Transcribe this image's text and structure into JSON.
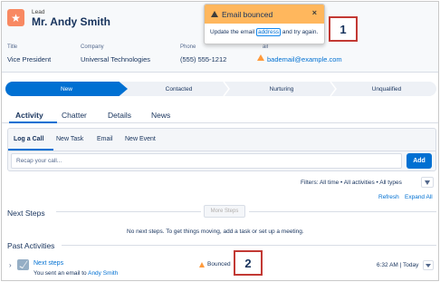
{
  "header": {
    "object_type": "Lead",
    "record_name": "Mr. Andy Smith",
    "icon": "star-icon",
    "fields": [
      {
        "label": "Title",
        "value": "Vice President"
      },
      {
        "label": "Company",
        "value": "Universal Technologies"
      },
      {
        "label": "Phone",
        "value": "(555) 555-1212"
      },
      {
        "label": "Email",
        "label_visible": "ail",
        "value": "bademail@example.com"
      }
    ]
  },
  "toast": {
    "title": "Email bounced",
    "message_before": "Update the email ",
    "message_link": "address",
    "message_after": " and try again.",
    "close_glyph": "×",
    "color": "#ffb75d"
  },
  "callouts": [
    "1",
    "2"
  ],
  "path": {
    "steps": [
      "New",
      "Contacted",
      "Nurturing",
      "Unqualified"
    ],
    "active_index": 0,
    "active_color": "#0070d2"
  },
  "tabs": [
    "Activity",
    "Chatter",
    "Details",
    "News"
  ],
  "publisher": {
    "tabs": [
      "Log a Call",
      "New Task",
      "Email",
      "New Event"
    ],
    "input_placeholder": "Recap your call...",
    "add_label": "Add"
  },
  "filters": {
    "text": "Filters: All time • All activities • All types",
    "refresh": "Refresh",
    "expand_all": "Expand All"
  },
  "next_steps": {
    "heading": "Next Steps",
    "button": "More Steps",
    "empty": "No next steps. To get things moving, add a task or set up a meeting."
  },
  "past_activities": {
    "heading": "Past Activities",
    "items": [
      {
        "title": "Next steps",
        "status": "Bounced",
        "time": "6:32 AM | Today",
        "summary": "You sent an email to ",
        "recipient": "Andy Smith"
      }
    ]
  },
  "colors": {
    "brand": "#0070d2",
    "lead_icon": "#f88962",
    "warning": "#ff9a3c",
    "callout_border": "#c23934"
  }
}
